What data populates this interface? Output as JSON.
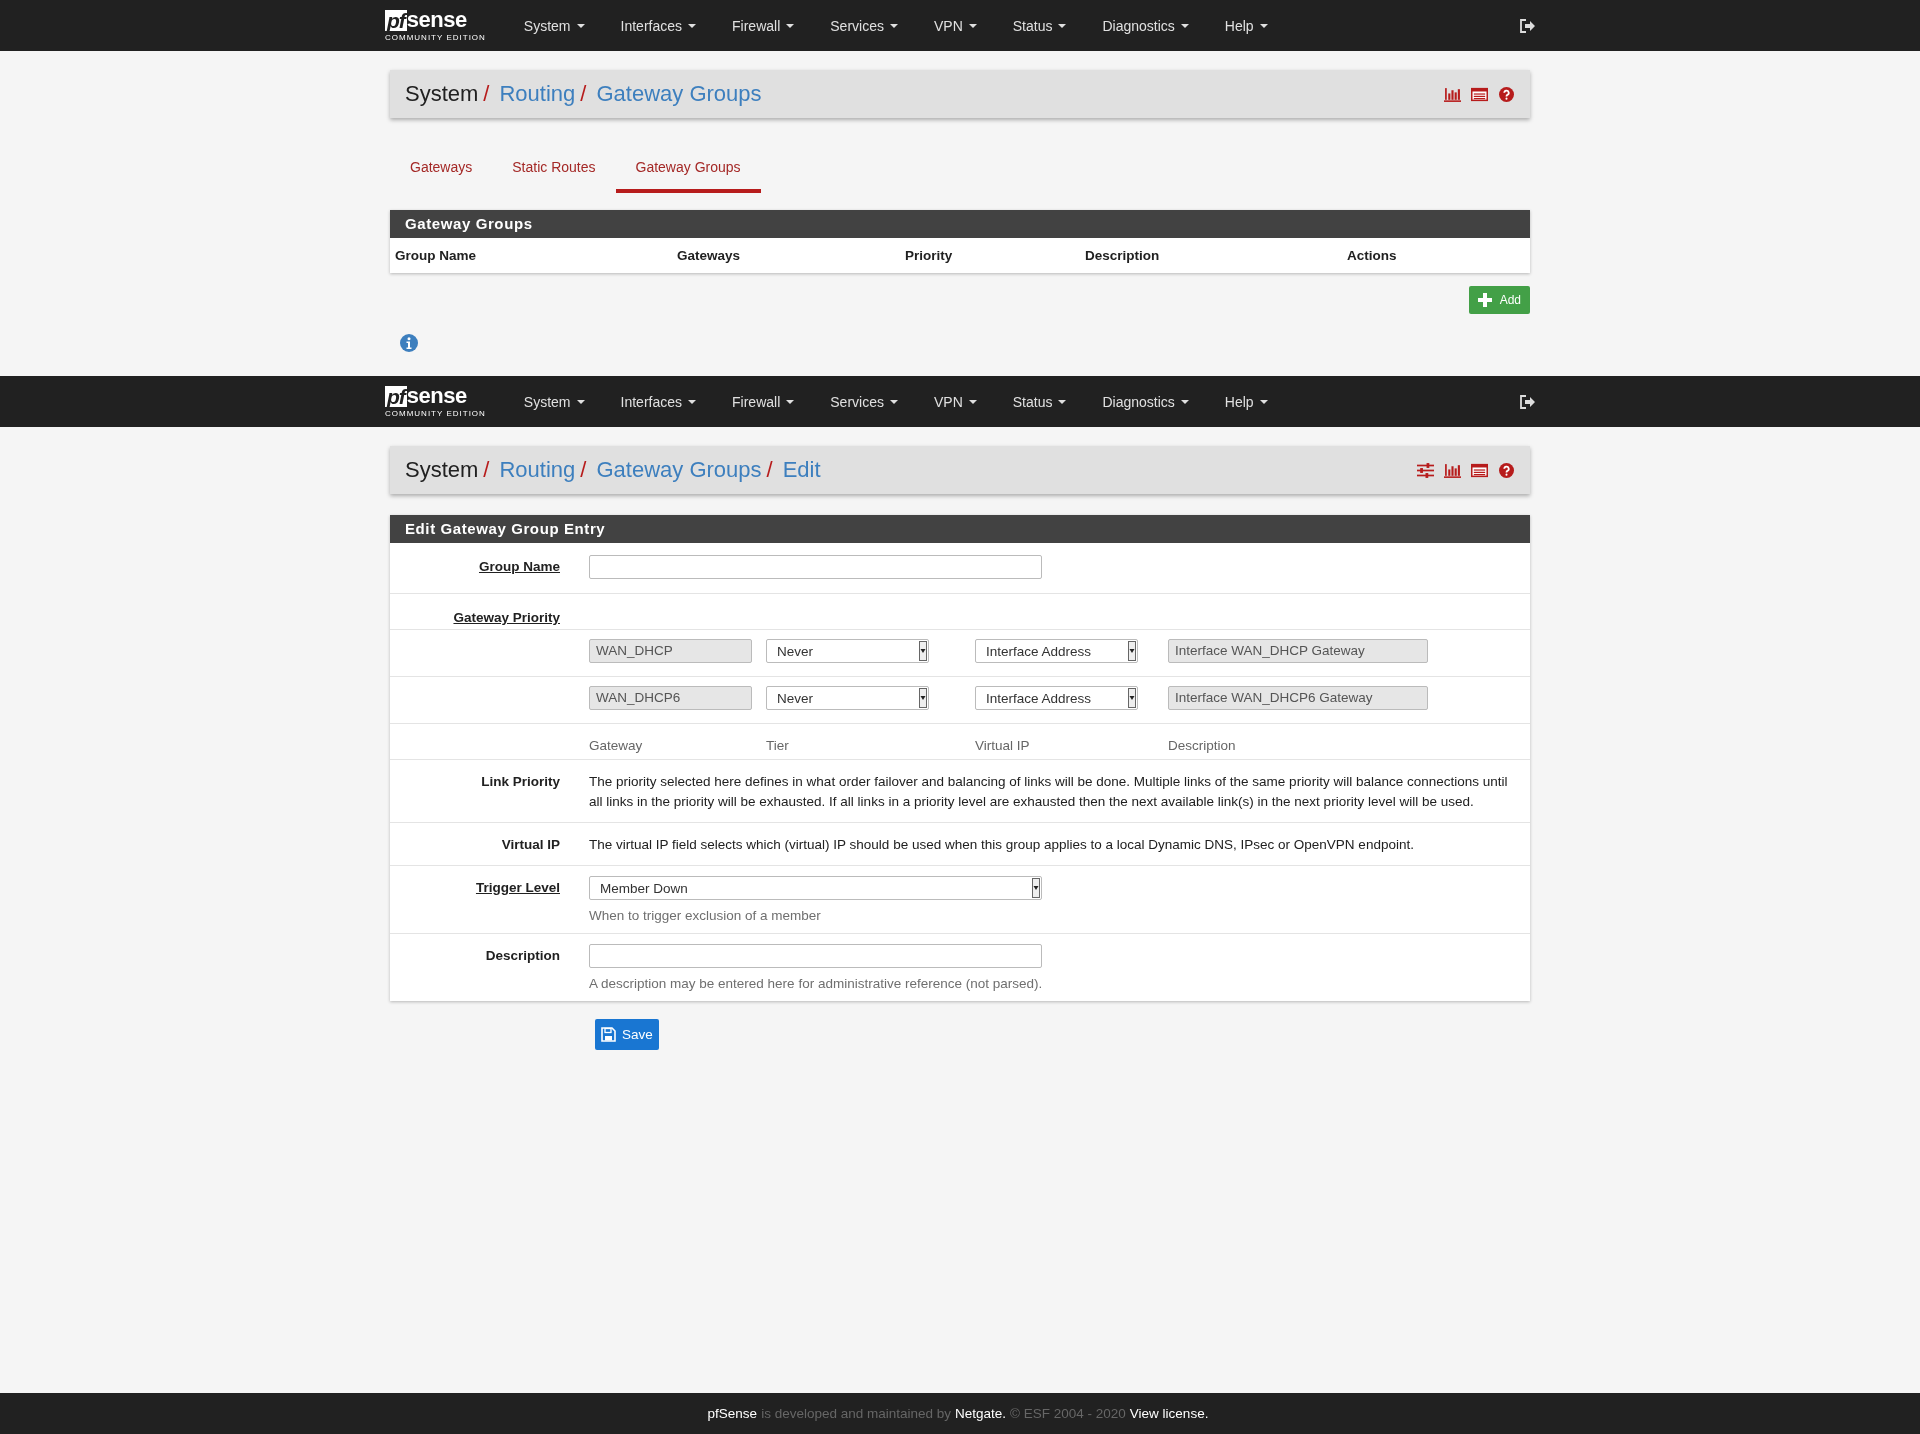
{
  "screens": [
    {
      "navbar": {
        "logo": {
          "mark": "pf",
          "word": "sense",
          "edition": "COMMUNITY EDITION"
        },
        "menus": [
          "System",
          "Interfaces",
          "Firewall",
          "Services",
          "VPN",
          "Status",
          "Diagnostics",
          "Help"
        ]
      },
      "breadcrumb": {
        "items": [
          {
            "text": "System",
            "kind": "plain"
          },
          {
            "text": "Routing",
            "kind": "link"
          },
          {
            "text": "Gateway Groups",
            "kind": "link"
          }
        ],
        "separator": "/",
        "icons": [
          {
            "kind": "chart"
          },
          {
            "kind": "table"
          },
          {
            "kind": "help"
          }
        ]
      },
      "tabs": [
        {
          "label": "Gateways",
          "selected": false
        },
        {
          "label": "Static Routes",
          "selected": false
        },
        {
          "label": "Gateway Groups",
          "selected": true
        }
      ],
      "table": {
        "title": "Gateway Groups",
        "columns": [
          "Group Name",
          "Gateways",
          "Priority",
          "Description",
          "Actions"
        ]
      },
      "add_button": "Add"
    },
    {
      "navbar": {
        "logo": {
          "mark": "pf",
          "word": "sense",
          "edition": "COMMUNITY EDITION"
        },
        "menus": [
          "System",
          "Interfaces",
          "Firewall",
          "Services",
          "VPN",
          "Status",
          "Diagnostics",
          "Help"
        ]
      },
      "breadcrumb": {
        "items": [
          {
            "text": "System",
            "kind": "plain"
          },
          {
            "text": "Routing",
            "kind": "link"
          },
          {
            "text": "Gateway Groups",
            "kind": "link"
          },
          {
            "text": "Edit",
            "kind": "link"
          }
        ],
        "separator": "/",
        "icons": [
          {
            "kind": "sliders"
          },
          {
            "kind": "chart"
          },
          {
            "kind": "table"
          },
          {
            "kind": "help"
          }
        ]
      },
      "form": {
        "title": "Edit Gateway Group Entry",
        "group_name": {
          "label": "Group Name",
          "underlined": true
        },
        "gateway_priority": {
          "label": "Gateway Priority",
          "underlined": true,
          "rows": [
            {
              "gateway": "WAN_DHCP",
              "tier": "Never",
              "virtual_ip": "Interface Address",
              "description": "Interface WAN_DHCP Gateway"
            },
            {
              "gateway": "WAN_DHCP6",
              "tier": "Never",
              "virtual_ip": "Interface Address",
              "description": "Interface WAN_DHCP6 Gateway"
            }
          ],
          "columns": [
            "Gateway",
            "Tier",
            "Virtual IP",
            "Description"
          ]
        },
        "info_rows": [
          {
            "label": "Link Priority",
            "text": "The priority selected here defines in what order failover and balancing of links will be done. Multiple links of the same priority will balance connections until all links in the priority will be exhausted. If all links in a priority level are exhausted then the next available link(s) in the next priority level will be used."
          },
          {
            "label": "Virtual IP",
            "text": "The virtual IP field selects which (virtual) IP should be used when this group applies to a local Dynamic DNS, IPsec or OpenVPN endpoint."
          }
        ],
        "trigger_level": {
          "label": "Trigger Level",
          "underlined": true,
          "value": "Member Down",
          "help": "When to trigger exclusion of a member"
        },
        "description": {
          "label": "Description",
          "underlined": false,
          "help": "A description may be entered here for administrative reference (not parsed)."
        }
      },
      "save_button": "Save"
    }
  ],
  "footer": [
    {
      "text": "pfSense",
      "kind": "bright"
    },
    {
      "text": "is developed and maintained by",
      "kind": "dim"
    },
    {
      "text": "Netgate.",
      "kind": "link"
    },
    {
      "text": "© ESF 2004 - 2020",
      "kind": "dim"
    },
    {
      "text": "View license.",
      "kind": "link"
    }
  ]
}
